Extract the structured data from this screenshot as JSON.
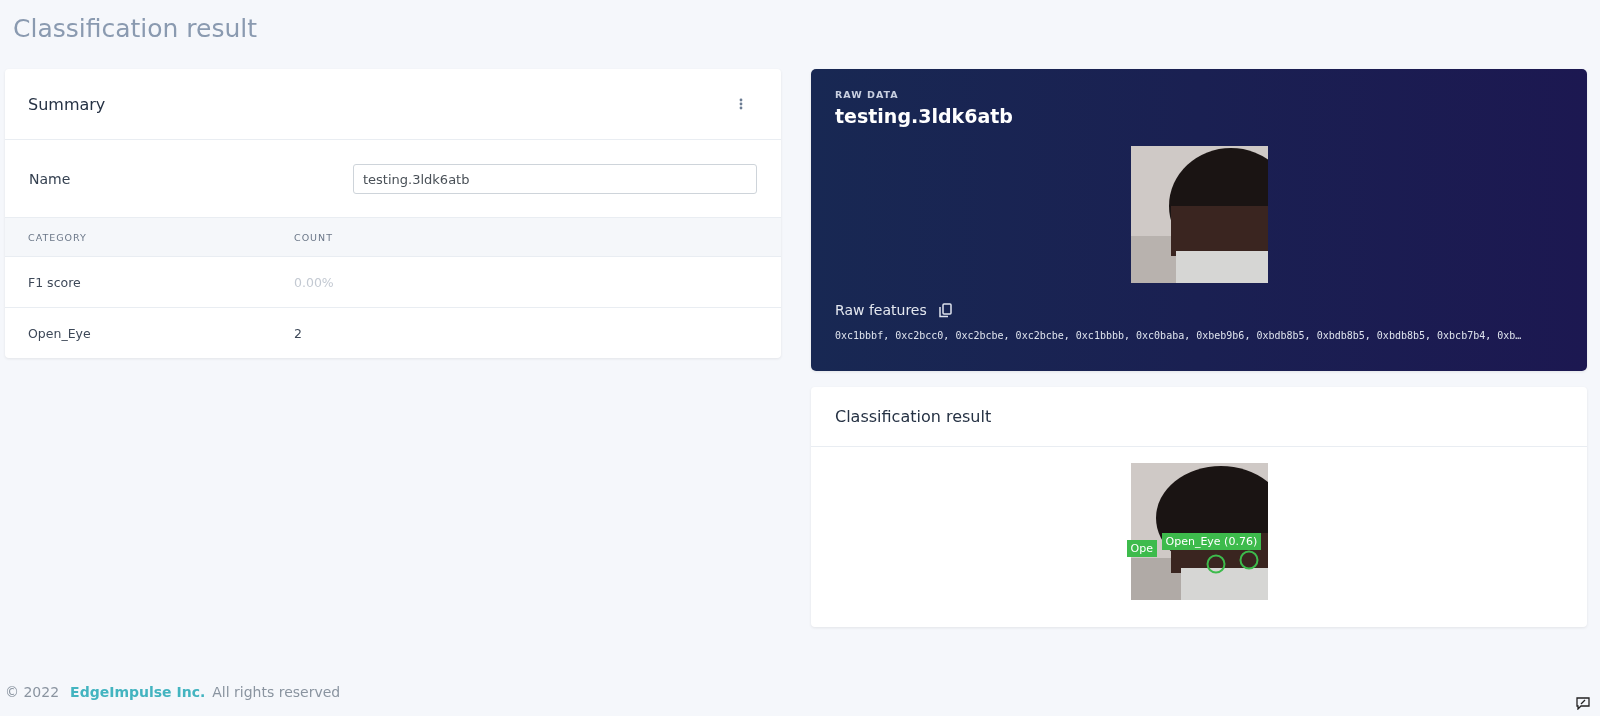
{
  "page_title": "Classification result",
  "summary": {
    "title": "Summary",
    "name_label": "Name",
    "name_value": "testing.3ldk6atb",
    "columns": [
      "CATEGORY",
      "COUNT"
    ],
    "rows": [
      {
        "category": "F1 score",
        "count": "0.00%",
        "muted": true
      },
      {
        "category": "Open_Eye",
        "count": "2",
        "muted": false
      }
    ]
  },
  "raw_data": {
    "eyebrow": "RAW DATA",
    "title": "testing.3ldk6atb",
    "features_label": "Raw features",
    "features": "0xc1bbbf, 0xc2bcc0, 0xc2bcbe, 0xc2bcbe, 0xc1bbbb, 0xc0baba, 0xbeb9b6, 0xbdb8b5, 0xbdb8b5, 0xbdb8b5, 0xbcb7b4, 0xb…"
  },
  "classification": {
    "title": "Classification result",
    "detections": [
      {
        "label": "Ope"
      },
      {
        "label": "Open_Eye (0.76)"
      }
    ]
  },
  "footer": {
    "copyright": "© 2022",
    "company": "EdgeImpulse Inc.",
    "rights": "All rights reserved"
  }
}
